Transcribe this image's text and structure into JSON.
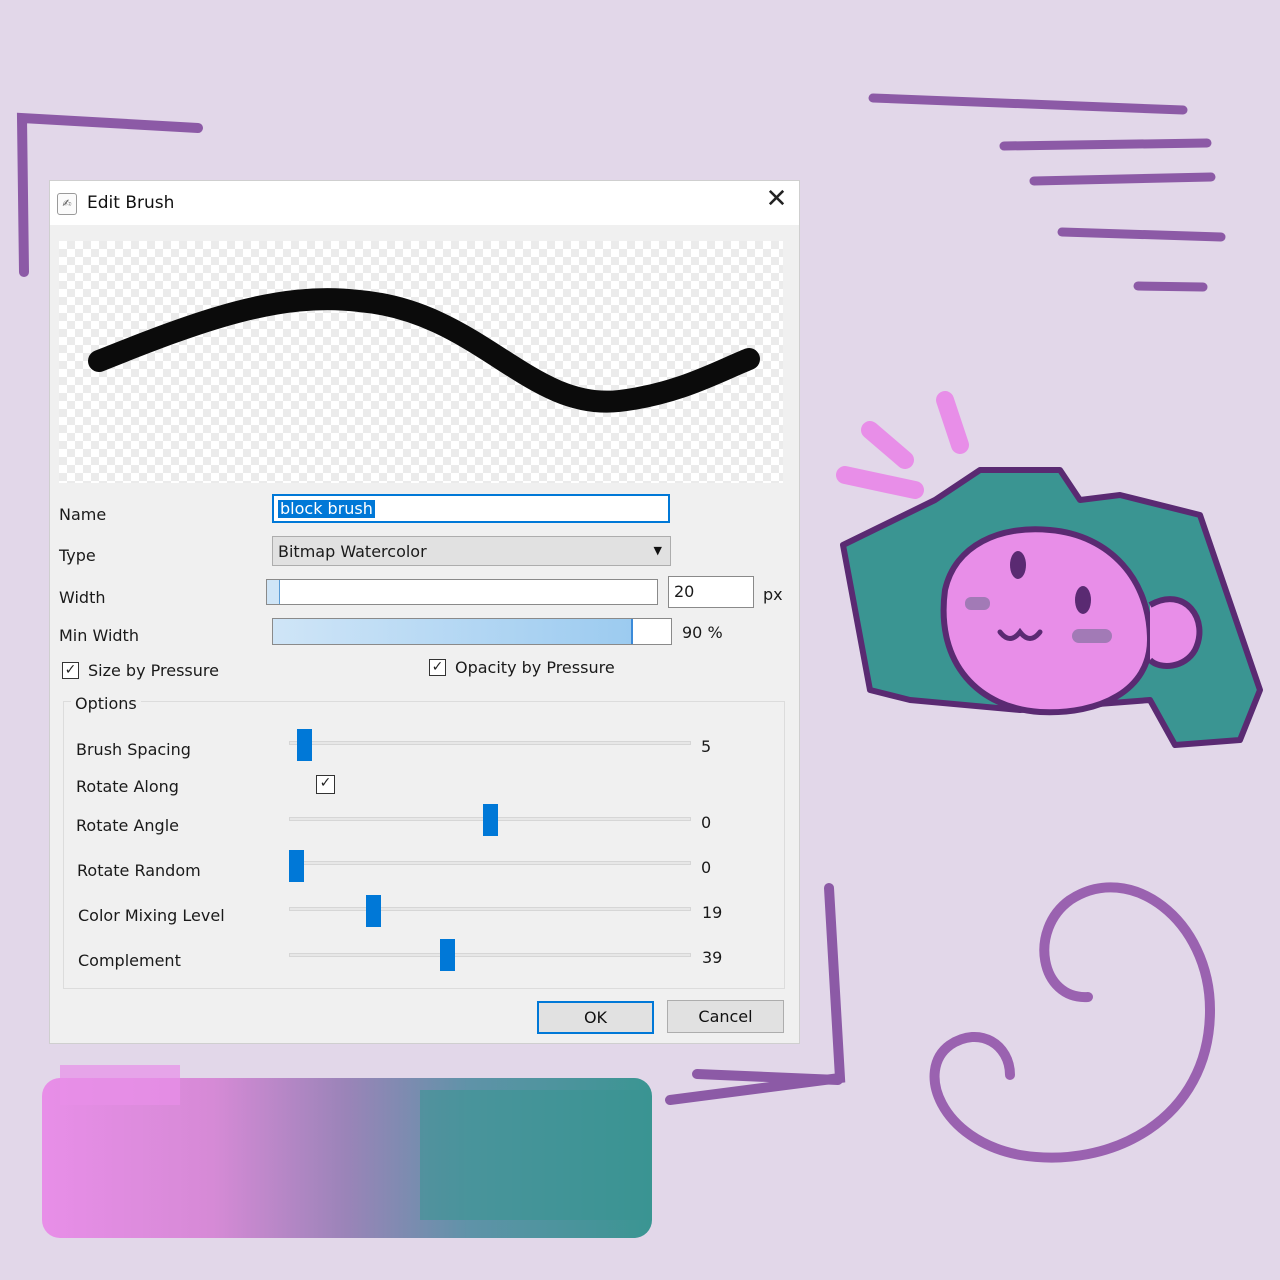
{
  "dialog": {
    "title": "Edit Brush",
    "name_label": "Name",
    "name_value": "block brush",
    "type_label": "Type",
    "type_value": "Bitmap Watercolor",
    "width_label": "Width",
    "width_value": "20",
    "width_unit": "px",
    "width_fraction": 0.03,
    "min_width_label": "Min Width",
    "min_width_value": "90 %",
    "min_width_fraction": 0.9,
    "size_by_pressure_label": "Size by Pressure",
    "size_by_pressure_checked": true,
    "opacity_by_pressure_label": "Opacity by Pressure",
    "opacity_by_pressure_checked": true,
    "options_title": "Options",
    "options": {
      "brush_spacing": {
        "label": "Brush Spacing",
        "value": "5",
        "fraction": 0.02
      },
      "rotate_along": {
        "label": "Rotate Along",
        "checked": true
      },
      "rotate_angle": {
        "label": "Rotate Angle",
        "value": "0",
        "fraction": 0.5
      },
      "rotate_random": {
        "label": "Rotate Random",
        "value": "0",
        "fraction": 0.0
      },
      "color_mixing_level": {
        "label": "Color Mixing Level",
        "value": "19",
        "fraction": 0.2
      },
      "complement": {
        "label": "Complement",
        "value": "39",
        "fraction": 0.39
      }
    },
    "ok_label": "OK",
    "cancel_label": "Cancel"
  },
  "icons": {
    "close": "close-icon",
    "app": "app-icon",
    "dropdown": "chevron-down-icon",
    "check": "checkmark-icon"
  },
  "colors": {
    "background": "#e2d7e9",
    "accent": "#0078d7",
    "stroke_purple": "#8c5aa6",
    "teal": "#3a9592",
    "pink": "#e88ee8"
  }
}
